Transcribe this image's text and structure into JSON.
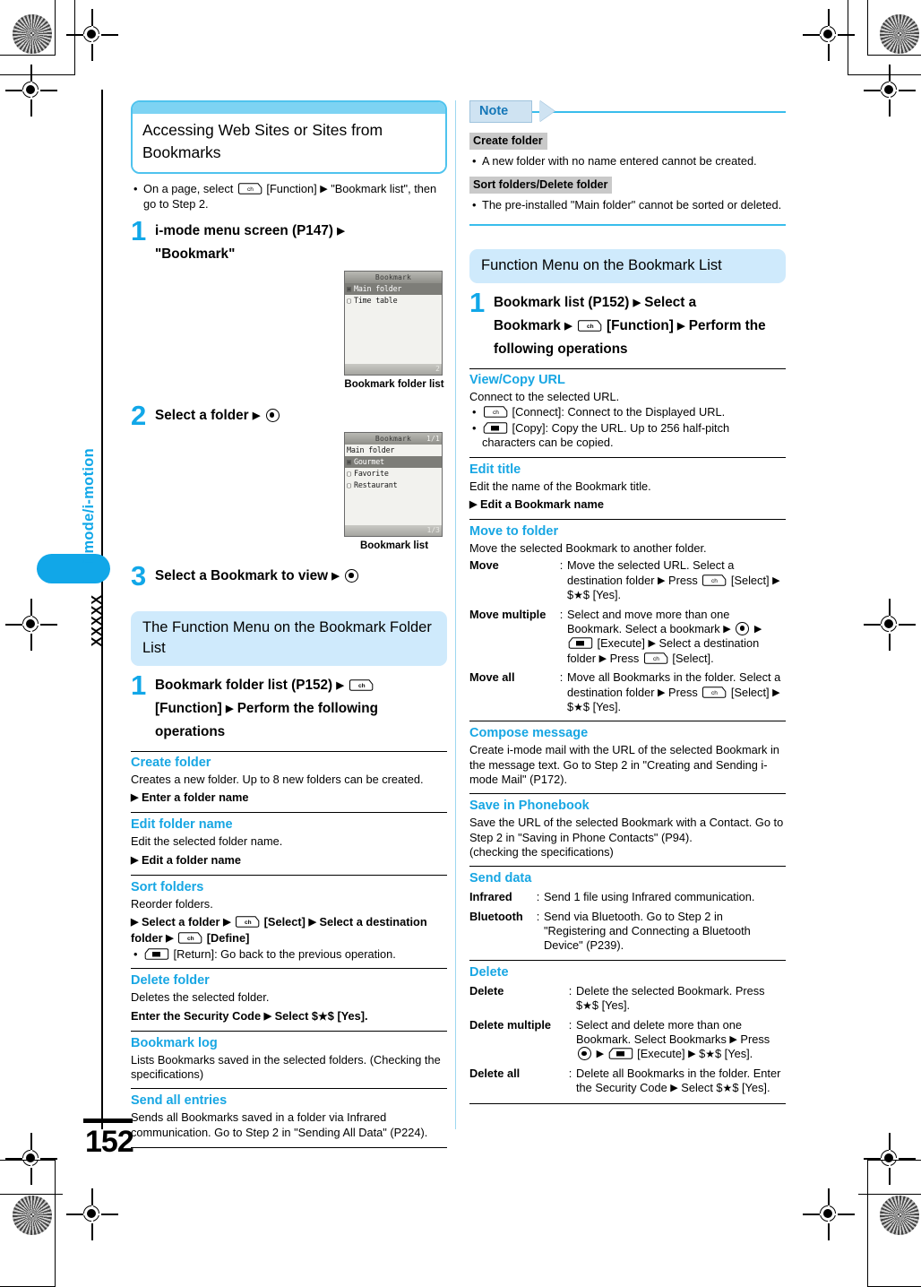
{
  "page": {
    "number": "152",
    "side_tab_label": "i-mode/i-motion",
    "side_tab_code": "XXXXX"
  },
  "left_column": {
    "main_heading": "Accessing Web Sites or Sites from Bookmarks",
    "intro_bullet": "On a page, select  [Function]  \"Bookmark list\", then go to Step 2.",
    "steps": [
      {
        "num": "1",
        "text": "i-mode menu screen (P147)  \"Bookmark\""
      },
      {
        "num": "2",
        "text": "Select a folder  "
      },
      {
        "num": "3",
        "text": "Select a Bookmark to view  "
      }
    ],
    "figure1": {
      "caption": "Bookmark folder list",
      "title": "Bookmark",
      "page_indicator": "",
      "rows": [
        {
          "icon": "folder-open-icon",
          "text": "Main folder",
          "selected": true
        },
        {
          "icon": "folder-icon",
          "text": "Time table",
          "selected": false
        }
      ],
      "status": "2"
    },
    "figure2": {
      "caption": "Bookmark list",
      "title": "Bookmark",
      "page_indicator": "1/1",
      "rows": [
        {
          "icon": "",
          "text": "Main folder",
          "selected": false
        },
        {
          "icon": "bookmark-icon",
          "text": "Gourmet",
          "selected": true
        },
        {
          "icon": "bookmark-icon",
          "text": "Favorite",
          "selected": false
        },
        {
          "icon": "bookmark-icon",
          "text": "Restaurant",
          "selected": false
        }
      ],
      "status": "1/3"
    },
    "sub_heading": "The Function Menu on the Bookmark Folder List",
    "sub_step": {
      "num": "1",
      "text": "Bookmark folder list (P152)   [Function]  Perform the following operations"
    },
    "entries": [
      {
        "title": "Create folder",
        "body": "Creates a new folder. Up to 8 new folders can be created.",
        "op": " Enter a folder name"
      },
      {
        "title": "Edit folder name",
        "body": "Edit the selected folder name.",
        "op": " Edit a folder name"
      },
      {
        "title": "Sort folders",
        "body": "Reorder folders.",
        "op_rich": true,
        "op": " Select a folder   [Select]  Select a destination folder   [Define]",
        "sub_bullet": " [Return]: Go back to the previous operation."
      },
      {
        "title": "Delete folder",
        "body": "Deletes the selected folder.",
        "op": "Enter the Security Code  Select $★$ [Yes]."
      },
      {
        "title": "Bookmark log",
        "body": "Lists Bookmarks saved in the selected folders. (Checking the specifications)",
        "op": ""
      },
      {
        "title": "Send all entries",
        "body": "Sends all Bookmarks saved in a folder via Infrared communication. Go to Step 2 in \"Sending All Data\" (P224).",
        "op": ""
      }
    ]
  },
  "right_column": {
    "note": {
      "label": "Note",
      "groups": [
        {
          "label": "Create folder",
          "bullets": [
            "A new folder with no name entered cannot be created."
          ]
        },
        {
          "label": "Sort folders/Delete folder",
          "bullets": [
            "The pre-installed \"Main folder\" cannot be sorted or deleted."
          ]
        }
      ]
    },
    "sub_heading": "Function Menu on the Bookmark List",
    "sub_step": {
      "num": "1",
      "text": "Bookmark list (P152)  Select a Bookmark   [Function]  Perform the following operations"
    },
    "entries": [
      {
        "title": "View/Copy URL",
        "body": "Connect to the selected URL.",
        "bullets": [
          " [Connect]: Connect to the Displayed URL.",
          " [Copy]: Copy the URL. Up to 256 half-pitch characters can be copied."
        ]
      },
      {
        "title": "Edit title",
        "body": "Edit the name of the Bookmark title.",
        "op": " Edit a Bookmark name"
      },
      {
        "title": "Move to folder",
        "body": "Move the selected Bookmark to another folder.",
        "rows": [
          {
            "term": "Move",
            "desc": "Move the selected URL. Select a destination folder  Press  [Select]  $★$ [Yes]."
          },
          {
            "term": "Move multiple",
            "desc": "Select and move more than one Bookmark. Select a bookmark    [Execute]  Select a destination folder  Press  [Select]."
          },
          {
            "term": "Move all",
            "desc": "Move all Bookmarks in the folder. Select a destination folder  Press  [Select]  $★$ [Yes]."
          }
        ]
      },
      {
        "title": "Compose message",
        "body": "Create i-mode mail with the URL of the selected Bookmark in the message text. Go to Step 2 in \"Creating and Sending i-mode Mail\" (P172)."
      },
      {
        "title": "Save in Phonebook",
        "body": "Save the URL of the selected Bookmark with a Contact. Go to Step 2 in \"Saving in Phone Contacts\" (P94).\n(checking the specifications)"
      },
      {
        "title": "Send data",
        "rows": [
          {
            "term": "Infrared",
            "desc": "Send 1 file using Infrared communication."
          },
          {
            "term": "Bluetooth",
            "desc": "Send via Bluetooth. Go to Step 2 in \"Registering and Connecting a Bluetooth Device\" (P239)."
          }
        ]
      },
      {
        "title": "Delete",
        "rows": [
          {
            "term": "Delete",
            "desc": "Delete the selected Bookmark. Press $★$ [Yes]."
          },
          {
            "term": "Delete multiple",
            "desc": "Select and delete more than one Bookmark. Select Bookmarks  Press    [Execute]  $★$ [Yes]."
          },
          {
            "term": "Delete all",
            "desc": "Delete all Bookmarks in the folder. Enter the Security Code  Select $★$ [Yes]."
          }
        ]
      }
    ]
  },
  "colors": {
    "accent_blue": "#17a6e3",
    "heading_fill": "#cfeafc",
    "heading_bar": "#7dd3f3",
    "note_tag": "#cfe3f2",
    "note_rule": "#39bdec",
    "gray_label": "#c9c9c9"
  }
}
